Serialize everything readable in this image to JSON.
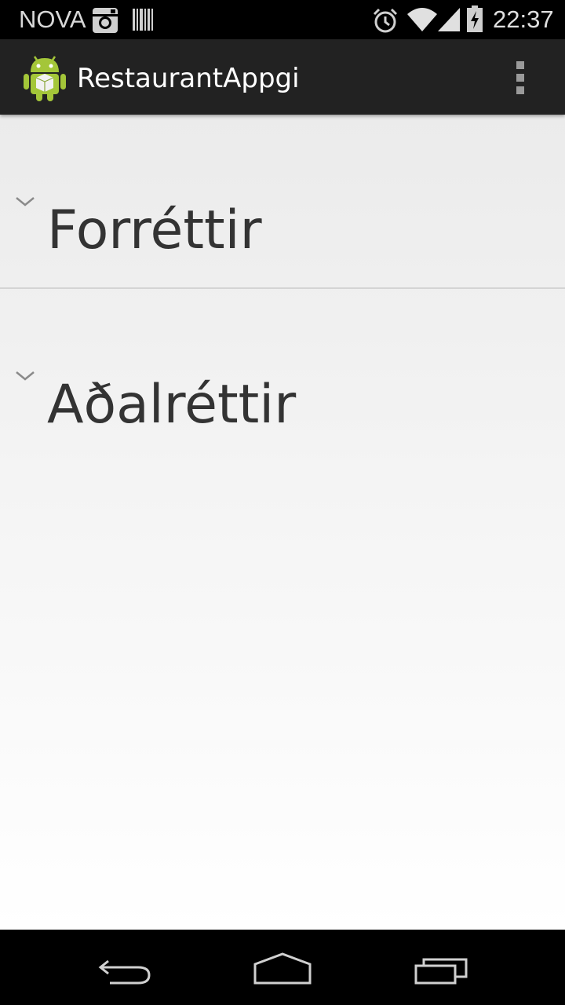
{
  "status_bar": {
    "carrier": "NOVA",
    "time": "22:37",
    "icons": [
      "instagram-icon",
      "barcode-icon",
      "alarm-icon",
      "wifi-icon",
      "signal-icon",
      "battery-charging-icon"
    ]
  },
  "action_bar": {
    "title": "RestaurantAppgi",
    "app_icon": "android-icon",
    "overflow_icon": "overflow-menu-icon"
  },
  "groups": [
    {
      "label": "Forréttir",
      "icon": "chevron-down-icon"
    },
    {
      "label": "Aðalréttir",
      "icon": "chevron-down-icon"
    }
  ],
  "nav_bar": {
    "icons": [
      "back-icon",
      "home-icon",
      "recents-icon"
    ]
  },
  "colors": {
    "action_bar_bg": "#222222",
    "status_bar_bg": "#000000",
    "list_text": "#333333",
    "divider": "#d4d4d4",
    "android_green": "#a4c639"
  }
}
